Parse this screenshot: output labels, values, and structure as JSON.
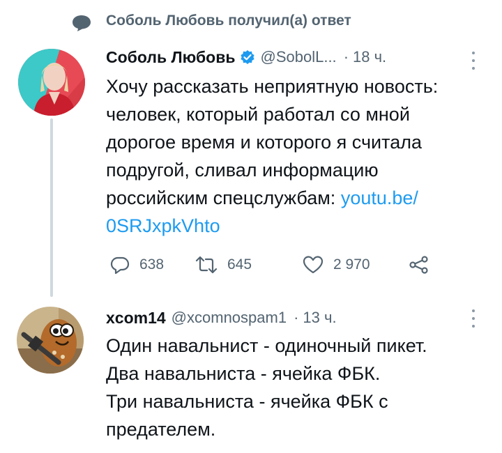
{
  "context": {
    "text": "Соболь Любовь получил(а) ответ"
  },
  "tweets": [
    {
      "author_name": "Соболь Любовь",
      "handle": "@SobolL...",
      "separator": "·",
      "time": "18 ч.",
      "verified": true,
      "text_lines": [
        "Хочу рассказать неприятную новость:",
        "человек, который работал со мной",
        "дорогое время и которого я считала",
        "подругой, сливал информацию",
        "российским спецслужбам: "
      ],
      "link_part1": "youtu.be/",
      "link_part2": "0SRJxpkVhto",
      "actions": {
        "replies": "638",
        "retweets": "645",
        "likes": "2 970"
      }
    },
    {
      "author_name": "xcom14",
      "handle": "@xcomnospam1",
      "separator": "·",
      "time": "13 ч.",
      "verified": false,
      "text_lines": [
        "Один навальнист - одиночный пикет.",
        "Два навальниста - ячейка ФБК.",
        "Три навальниста - ячейка ФБК с",
        "предателем."
      ]
    }
  ],
  "colors": {
    "text": "#0f1419",
    "secondary": "#536471",
    "link": "#1d9bf0",
    "verified": "#1d9bf0",
    "thread_line": "#cfd9de"
  },
  "icons": [
    "speech-bubble-icon",
    "verified-badge-icon",
    "more-icon",
    "reply-icon",
    "retweet-icon",
    "like-icon",
    "share-icon"
  ]
}
